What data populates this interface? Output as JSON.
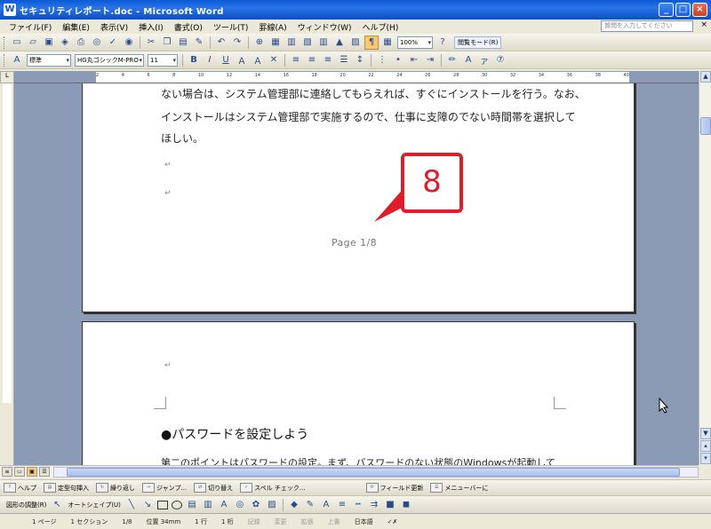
{
  "window": {
    "title": "セキュリティレポート.doc - Microsoft Word",
    "controls": [
      "_",
      "□",
      "×"
    ]
  },
  "menu": {
    "items": [
      "ファイル(F)",
      "編集(E)",
      "表示(V)",
      "挿入(I)",
      "書式(O)",
      "ツール(T)",
      "罫線(A)",
      "ウィンドウ(W)",
      "ヘルプ(H)"
    ],
    "help_placeholder": "質問を入力してください",
    "close": "×"
  },
  "toolbar_standard": {
    "zoom": "100%",
    "reading_mode": "閲覧モード(R)"
  },
  "toolbar_format": {
    "style": "標準",
    "font": "HG丸ゴシックM-PRO",
    "size": "11",
    "bold": "B",
    "italic": "I",
    "underline": "U"
  },
  "document": {
    "page1_lines": [
      "ない場合は、システム管理部に連絡してもらえれば、すぐにインストールを行う。なお、",
      "インストールはシステム管理部で実施するので、仕事に支障のでない時間帯を選択して",
      "ほしい。"
    ],
    "para_mark": "↵",
    "footer": "Page 1/8",
    "heading": "●パスワードを設定しよう",
    "page2_partial": "第二のポイントはパスワードの設定。まず、パスワードのない状態のWindowsが起動して"
  },
  "callout": {
    "number": "8",
    "color": "#e01c2a"
  },
  "help_bar": {
    "items": [
      "ヘルプ",
      "定型句挿入",
      "繰り返し",
      "ジャンプ...",
      "切り替え",
      "スペル チェック...",
      "フィールド更新",
      "メニューバーに"
    ]
  },
  "draw_bar": {
    "draw": "図形の調整(R)",
    "autoshapes": "オートシェイプ(U)"
  },
  "status_bar": {
    "page": "1 ページ",
    "section": "1 セクション",
    "page_of": "1/8",
    "position": "位置 34mm",
    "line": "1 行",
    "column": "1 桁",
    "rec": "記録",
    "trk": "変更",
    "ext": "拡張",
    "ovr": "上書",
    "language": "日本語"
  }
}
